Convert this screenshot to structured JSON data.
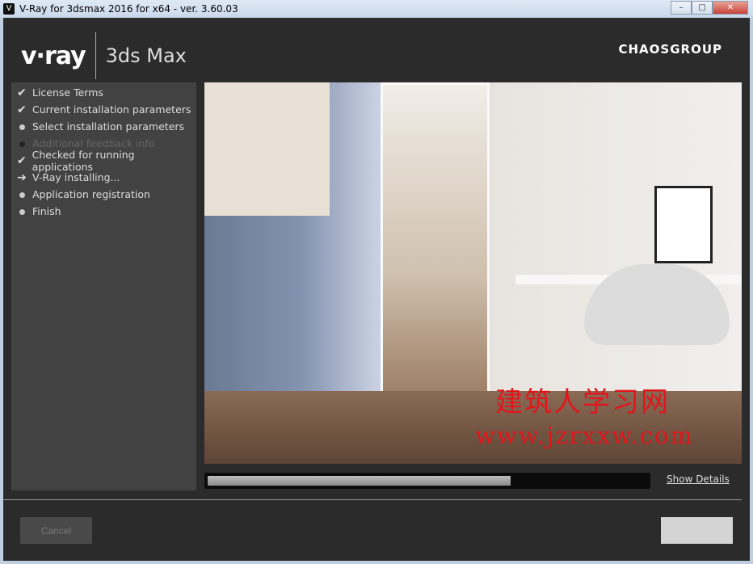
{
  "window": {
    "title": "V-Ray for 3dsmax 2016 for x64 - ver. 3.60.03",
    "controls": [
      "minimize",
      "maximize",
      "close"
    ]
  },
  "header": {
    "brand": "v·ray",
    "product": "3ds Max",
    "company": "CHAOSGROUP"
  },
  "steps": [
    {
      "label": "License Terms",
      "state": "done",
      "icon": "check-icon"
    },
    {
      "label": "Current installation parameters",
      "state": "done",
      "icon": "check-icon"
    },
    {
      "label": "Select installation parameters",
      "state": "pending",
      "icon": "dot-icon"
    },
    {
      "label": "Additional feedback info",
      "state": "disabled",
      "icon": "dot-icon"
    },
    {
      "label": "Checked for running applications",
      "state": "done",
      "icon": "check-icon"
    },
    {
      "label": "V-Ray installing...",
      "state": "current",
      "icon": "arrow-right-icon"
    },
    {
      "label": "Application registration",
      "state": "pending",
      "icon": "dot-icon"
    },
    {
      "label": "Finish",
      "state": "pending",
      "icon": "dot-icon"
    }
  ],
  "watermark": {
    "line1": "建筑人学习网",
    "line2": "www.jzrxxw.com",
    "color": "#e2151b"
  },
  "progress": {
    "percent": 69
  },
  "links": {
    "show_details": "Show Details"
  },
  "buttons": {
    "cancel": "Cancel"
  }
}
